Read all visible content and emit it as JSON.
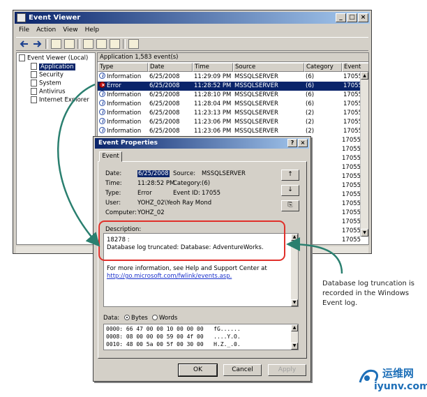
{
  "window": {
    "title": "Event Viewer",
    "min_btn": "_",
    "max_btn": "□",
    "close_btn": "×"
  },
  "menu": [
    "File",
    "Action",
    "View",
    "Help"
  ],
  "tree": {
    "root": "Event Viewer (Local)",
    "items": [
      "Application",
      "Security",
      "System",
      "Antivirus",
      "Internet Explorer"
    ]
  },
  "list": {
    "header": "Application   1,583 event(s)",
    "columns": [
      "Type",
      "Date",
      "Time",
      "Source",
      "Category",
      "Event"
    ],
    "rows": [
      {
        "type": "Information",
        "date": "6/25/2008",
        "time": "11:29:09 PM",
        "source": "MSSQLSERVER",
        "category": "(6)",
        "event": "17055",
        "icon": "info"
      },
      {
        "type": "Error",
        "date": "6/25/2008",
        "time": "11:28:52 PM",
        "source": "MSSQLSERVER",
        "category": "(6)",
        "event": "17055",
        "icon": "error"
      },
      {
        "type": "Information",
        "date": "6/25/2008",
        "time": "11:28:10 PM",
        "source": "MSSQLSERVER",
        "category": "(6)",
        "event": "17055",
        "icon": "info"
      },
      {
        "type": "Information",
        "date": "6/25/2008",
        "time": "11:28:04 PM",
        "source": "MSSQLSERVER",
        "category": "(6)",
        "event": "17055",
        "icon": "info"
      },
      {
        "type": "Information",
        "date": "6/25/2008",
        "time": "11:23:13 PM",
        "source": "MSSQLSERVER",
        "category": "(2)",
        "event": "17055",
        "icon": "info"
      },
      {
        "type": "Information",
        "date": "6/25/2008",
        "time": "11:23:06 PM",
        "source": "MSSQLSERVER",
        "category": "(2)",
        "event": "17055",
        "icon": "info"
      },
      {
        "type": "Information",
        "date": "6/25/2008",
        "time": "11:23:06 PM",
        "source": "MSSQLSERVER",
        "category": "(2)",
        "event": "17055",
        "icon": "info"
      }
    ],
    "hidden_events": [
      "17055",
      "17055",
      "17055",
      "17055",
      "17055",
      "17055",
      "17055",
      "17055",
      "17055",
      "17055",
      "17055",
      "17055"
    ]
  },
  "dialog": {
    "title": "Event Properties",
    "help_btn": "?",
    "close_btn": "×",
    "tab": "Event",
    "date_label": "Date:",
    "date_value": "6/25/2008",
    "source_label": "Source:",
    "source_value": "MSSQLSERVER",
    "time_label": "Time:",
    "time_value": "11:28:52 PM",
    "category_label": "Category:",
    "category_value": "(6)",
    "type_label": "Type:",
    "type_value": "Error",
    "eventid_label": "Event ID:",
    "eventid_value": "17055",
    "user_label": "User:",
    "user_value": "YOHZ_02\\Yeoh Ray Mond",
    "computer_label": "Computer:",
    "computer_value": "YOHZ_02",
    "up_btn": "↑",
    "down_btn": "↓",
    "copy_btn": "⎘",
    "description_label": "Description:",
    "description_code": "18278 :",
    "description_text": "Database log truncated: Database: AdventureWorks.",
    "more_info": "For more information, see Help and Support Center at",
    "more_link": "http://go.microsoft.com/fwlink/events.asp.",
    "data_label": "Data:",
    "bytes_label": "Bytes",
    "words_label": "Words",
    "hex_lines": [
      "0000: 66 47 00 00 10 00 00 00   fG......",
      "0008: 08 00 00 00 59 00 4f 00   ....Y.O.",
      "0010: 48 00 5a 00 5f 00 30 00   H.Z._.0."
    ],
    "ok": "OK",
    "cancel": "Cancel",
    "apply": "Apply"
  },
  "callout": {
    "lines": [
      "Database log truncation is",
      "recorded in the Windows",
      "Event log."
    ]
  },
  "watermark": {
    "cn": "运维网",
    "en": "iyunv.com"
  },
  "colors": {
    "title_bar": "#0a246a",
    "selection": "#0a246a",
    "highlight_box": "#e0302a",
    "arrow": "#2a7f6f",
    "watermark": "#1d6fb8"
  }
}
